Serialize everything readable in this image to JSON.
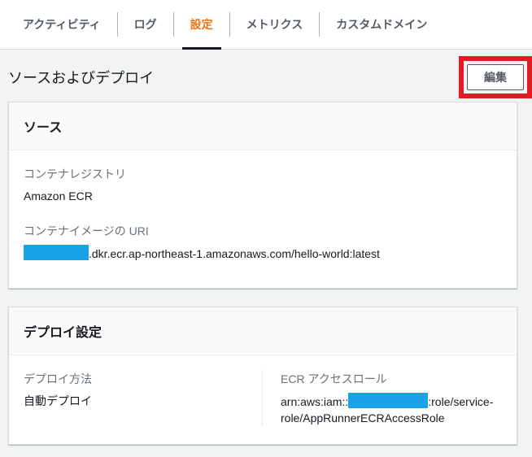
{
  "tabs": {
    "items": [
      {
        "label": "アクティビティ",
        "selected": false
      },
      {
        "label": "ログ",
        "selected": false
      },
      {
        "label": "設定",
        "selected": true
      },
      {
        "label": "メトリクス",
        "selected": false
      },
      {
        "label": "カスタムドメイン",
        "selected": false
      }
    ]
  },
  "section": {
    "title": "ソースおよびデプロイ",
    "edit_button_label": "編集"
  },
  "source_card": {
    "title": "ソース",
    "registry": {
      "label": "コンテナレジストリ",
      "value": "Amazon ECR"
    },
    "image_uri": {
      "label": "コンテナイメージの URI",
      "value_suffix": ".dkr.ecr.ap-northeast-1.amazonaws.com/hello-world:latest"
    }
  },
  "deploy_card": {
    "title": "デプロイ設定",
    "method": {
      "label": "デプロイ方法",
      "value": "自動デプロイ"
    },
    "access_role": {
      "label": "ECR アクセスロール",
      "value_prefix": "arn:aws:iam::",
      "value_suffix": ":role/service-role/AppRunnerECRAccessRole"
    }
  },
  "colors": {
    "accent_orange": "#ec7211",
    "annotation_red": "#e21b22",
    "redaction_blue": "#19a2e6",
    "page_bg": "#f2f3f3",
    "card_border": "#d5dbdb"
  }
}
